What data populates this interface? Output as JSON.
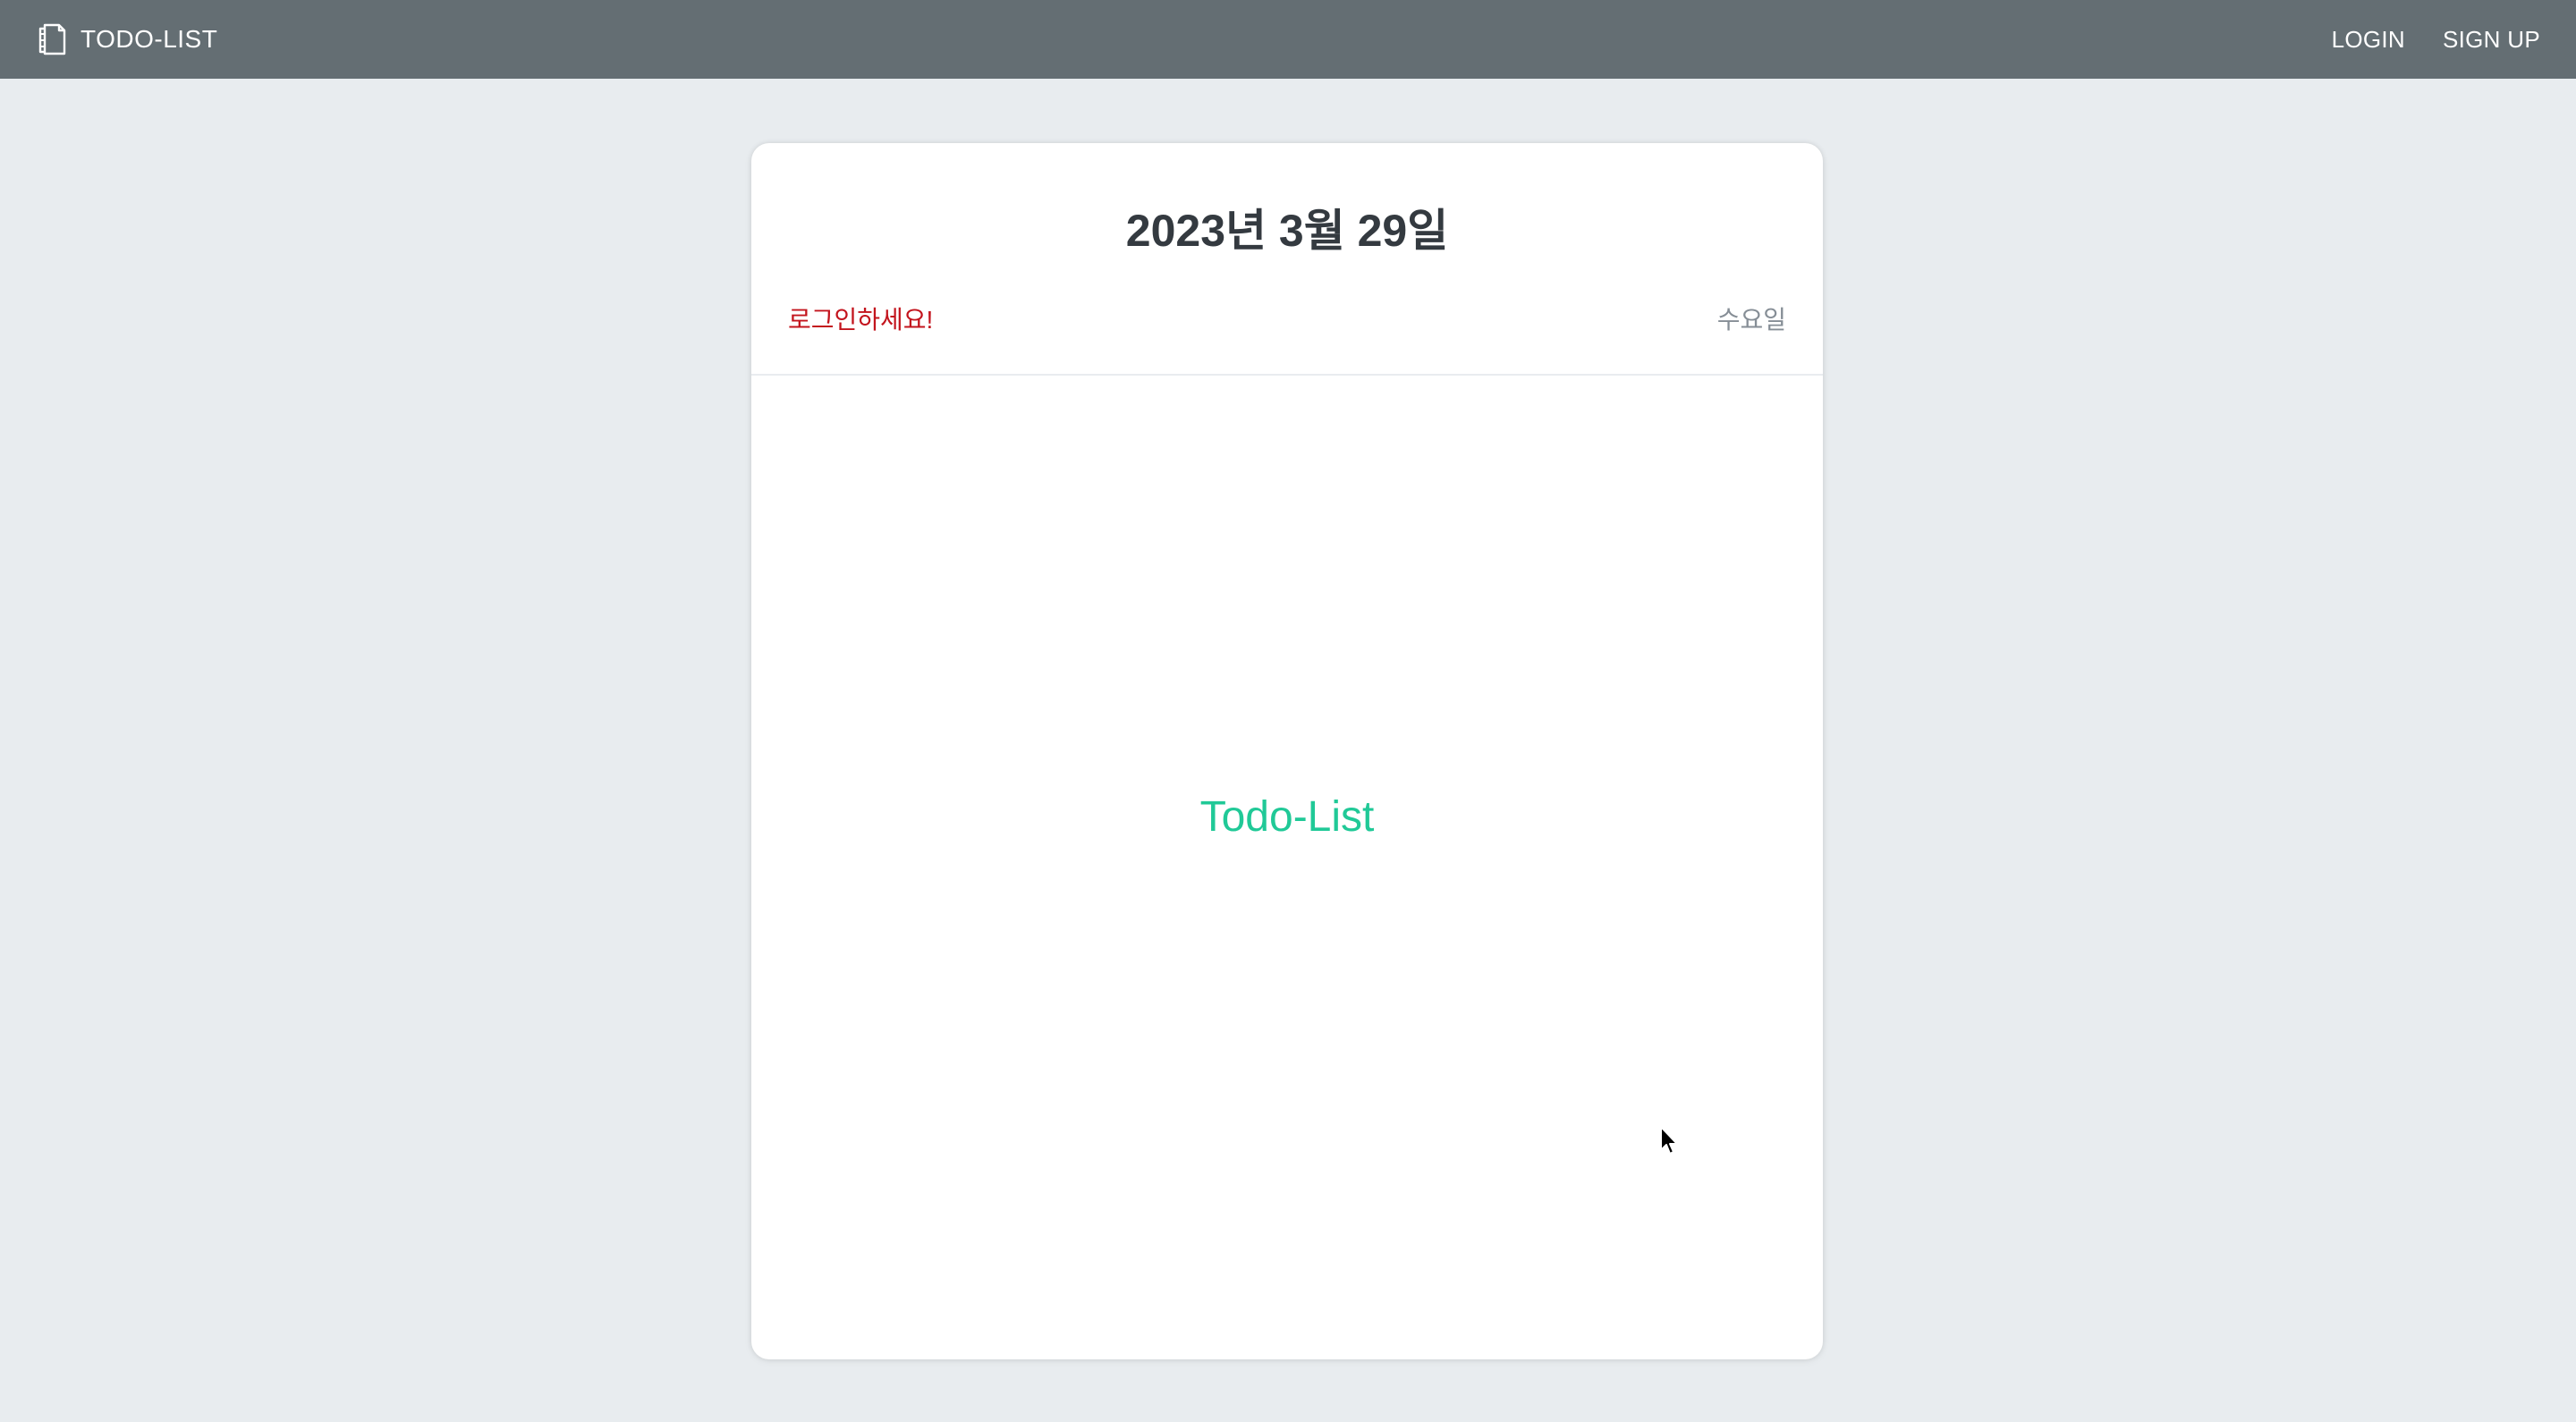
{
  "navbar": {
    "brand_icon": "notebook-icon",
    "brand": "TODO-LIST",
    "links": [
      "LOGIN",
      "SIGN UP"
    ]
  },
  "card": {
    "date": "2023년 3월 29일",
    "login_message": "로그인하세요!",
    "weekday": "수요일",
    "placeholder": "Todo-List"
  },
  "colors": {
    "navbar_bg": "#646e73",
    "page_bg": "#e8ecef",
    "login_message": "#c3141d",
    "placeholder": "#20c997",
    "title": "#343a40",
    "weekday": "#868e96"
  }
}
